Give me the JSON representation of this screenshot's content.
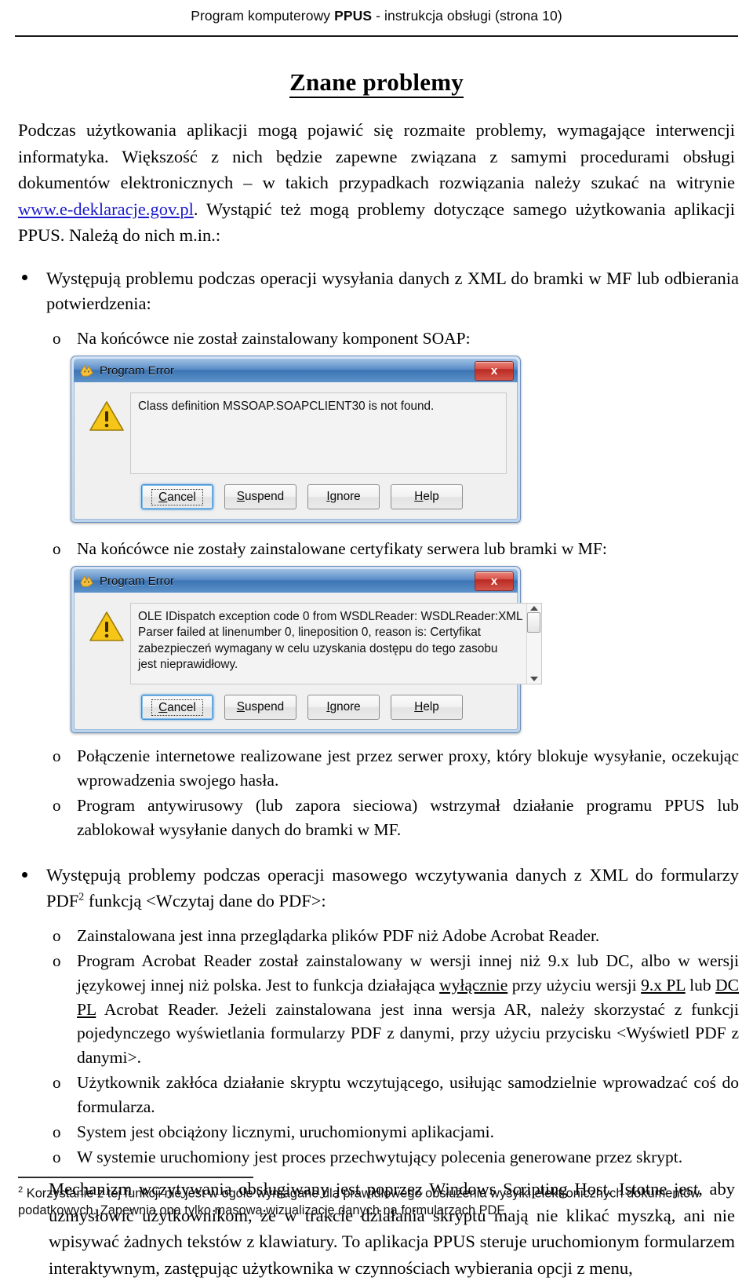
{
  "header": {
    "prefix": "Program komputerowy ",
    "app_name": "PPUS",
    "suffix": " - instrukcja obsługi  (strona 10)"
  },
  "title": "Znane problemy",
  "intro": {
    "part1": "Podczas użytkowania aplikacji mogą pojawić się rozmaite problemy, wymagające interwencji informatyka. Większość z nich będzie zapewne związana z samymi procedurami obsługi dokumentów elektronicznych – w takich przypadkach rozwiązania należy szukać na witrynie ",
    "link": "www.e-deklaracje.gov.pl",
    "part2": ". Wystąpić też mogą problemy dotyczące samego użytkowania aplikacji PPUS. Należą do nich m.in.:"
  },
  "bullet1": {
    "text": "Występują problemu podczas operacji wysyłania danych z XML do bramki w MF lub odbierania potwierdzenia:",
    "sub1_label": "Na końcówce nie został zainstalowany komponent SOAP:",
    "sub2_label": "Na końcówce nie zostały zainstalowane certyfikaty serwera lub bramki w MF:",
    "sub3": "Połączenie internetowe realizowane jest przez serwer proxy, który blokuje wysyłanie, oczekując wprowadzenia swojego hasła.",
    "sub4": "Program antywirusowy (lub zapora sieciowa) wstrzymał działanie programu PPUS lub zablokował wysyłanie danych do bramki w MF."
  },
  "dialog1": {
    "title": "Program Error",
    "close_label": "x",
    "icon_name": "warning-icon",
    "app_icon_name": "program-error-app-icon",
    "message_lines": [
      "Class definition MSSOAP.SOAPCLIENT30 is not found."
    ],
    "has_scrollbar": false,
    "buttons": [
      {
        "label": "Cancel",
        "accel": "C",
        "focused": true
      },
      {
        "label": "Suspend",
        "accel": "S",
        "focused": false
      },
      {
        "label": "Ignore",
        "accel": "I",
        "focused": false
      },
      {
        "label": "Help",
        "accel": "H",
        "focused": false
      }
    ]
  },
  "dialog2": {
    "title": "Program Error",
    "close_label": "x",
    "icon_name": "warning-icon",
    "app_icon_name": "program-error-app-icon",
    "message_lines": [
      "OLE IDispatch exception code 0 from WSDLReader: WSDLReader:XML",
      "Parser failed at linenumber 0, lineposition 0, reason is: Certyfikat",
      "zabezpieczeń wymagany w celu uzyskania dostępu do tego zasobu",
      "jest nieprawidłowy."
    ],
    "has_scrollbar": true,
    "buttons": [
      {
        "label": "Cancel",
        "accel": "C",
        "focused": true
      },
      {
        "label": "Suspend",
        "accel": "S",
        "focused": false
      },
      {
        "label": "Ignore",
        "accel": "I",
        "focused": false
      },
      {
        "label": "Help",
        "accel": "H",
        "focused": false
      }
    ]
  },
  "bullet2": {
    "text_before_ref": "Występują problemy podczas operacji masowego wczytywania danych z XML do formularzy PDF",
    "footnote_ref": "2",
    "text_after_ref": " funkcją <Wczytaj dane do PDF>:",
    "sub1": "Zainstalowana jest inna przeglądarka plików PDF niż Adobe Acrobat Reader.",
    "sub2_a": "Program Acrobat Reader został zainstalowany w wersji innej niż 9.x lub DC, albo w wersji językowej innej niż polska. Jest to funkcja działająca ",
    "sub2_u1": "wyłącznie",
    "sub2_b": " przy użyciu wersji ",
    "sub2_u2": "9.x PL",
    "sub2_c": " lub ",
    "sub2_u3": "DC PL",
    "sub2_d": " Acrobat Reader. Jeżeli zainstalowana jest inna wersja AR, należy skorzystać z funkcji pojedynczego wyświetlania formularzy PDF z danymi, przy użyciu przycisku <Wyświetl PDF z danymi>.",
    "sub3": "Użytkownik zakłóca działanie skryptu wczytującego, usiłując samodzielnie wprowadzać coś do formularza.",
    "sub4": "System jest obciążony licznymi, uruchomionymi aplikacjami.",
    "sub5": "W systemie uruchomiony jest proces przechwytujący polecenia generowane przez skrypt."
  },
  "closing_paragraph": "Mechanizm wczytywania obsługiwany jest poprzez Windows Scripting Host. Istotne jest, aby uzmysłowić użytkownikom, że w trakcie działania skryptu mają nie klikać myszką, ani nie wpisywać żadnych tekstów z klawiatury. To aplikacja PPUS steruje uruchomionym formularzem interaktywnym, zastępując użytkownika w czynnościach wybierania opcji z menu,",
  "footnote": {
    "ref": "2",
    "text": " Korzystanie z tej funkcji nie jest w ogóle wymagane dla prawidłowego obsłużenia wysyłki elektronicznych dokumentów podatkowych. Zapewnia ona tylko masową wizualizację danych na formularzach PDF."
  },
  "colors": {
    "link": "#1a1acc",
    "titlebar_blue": "#4f86c4",
    "close_red": "#b92a22",
    "warning_yellow": "#f5c518"
  }
}
